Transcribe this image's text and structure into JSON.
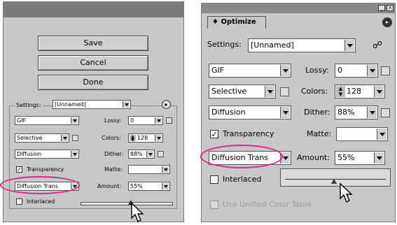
{
  "left": {
    "buttons": {
      "save": "Save",
      "cancel": "Cancel",
      "done": "Done"
    },
    "settings_label": "Settings:",
    "settings_value": "[Unnamed]",
    "format": "GIF",
    "lossy_label": "Lossy:",
    "lossy_value": "0",
    "reduction": "Selective",
    "colors_label": "Colors:",
    "colors_value": "128",
    "dither_algo": "Diffusion",
    "dither_label": "Dither:",
    "dither_value": "88%",
    "transparency_label": "Transparency",
    "matte_label": "Matte:",
    "transparency_dither": "Diffusion Trans",
    "amount_label": "Amount:",
    "amount_value": "55%",
    "interlaced_label": "Interlaced"
  },
  "right": {
    "tab_label": "Optimize",
    "settings_label": "Settings:",
    "settings_value": "[Unnamed]",
    "format": "GIF",
    "lossy_label": "Lossy:",
    "lossy_value": "0",
    "reduction": "Selective",
    "colors_label": "Colors:",
    "colors_value": "128",
    "dither_algo": "Diffusion",
    "dither_label": "Dither:",
    "dither_value": "88%",
    "transparency_label": "Transparency",
    "matte_label": "Matte:",
    "transparency_dither": "Diffusion Trans",
    "amount_label": "Amount:",
    "amount_value": "55%",
    "interlaced_label": "Interlaced",
    "unified_label": "Use Unified Color Table"
  },
  "colors": {
    "highlight": "#d22a86",
    "panel": "#c8c8c8"
  }
}
